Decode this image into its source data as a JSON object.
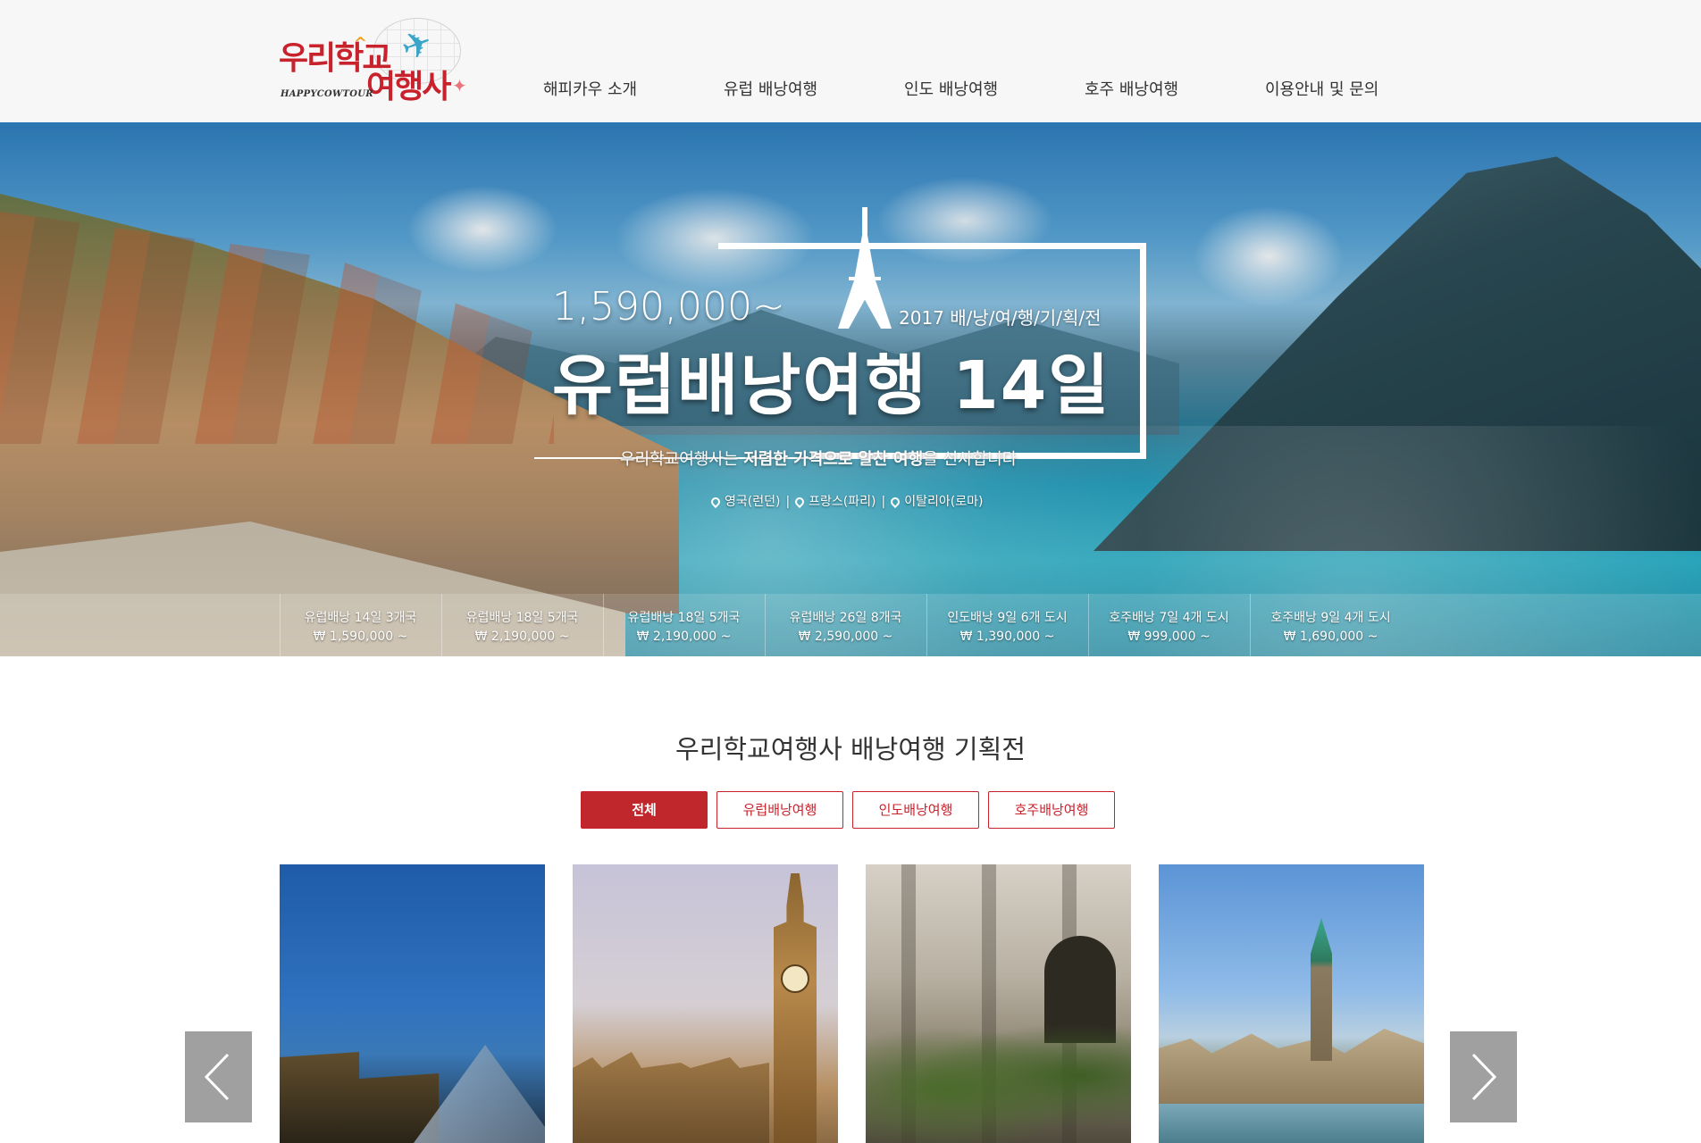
{
  "brand": {
    "logo_line1": "우리학교",
    "logo_line2": "여행사",
    "logo_sub": "HAPPYCOWTOUR",
    "accent_color": "#c8232c"
  },
  "nav": {
    "items": [
      {
        "label": "해피카우 소개"
      },
      {
        "label": "유럽 배낭여행"
      },
      {
        "label": "인도 배낭여행"
      },
      {
        "label": "호주 배낭여행"
      },
      {
        "label": "이용안내 및 문의"
      }
    ]
  },
  "hero": {
    "price": "1,590,000~",
    "subtitle": "2017 배/낭/여/행/기/획/전",
    "title": "유럽배낭여행  14일",
    "tagline_prefix": "우리학교여행사는 ",
    "tagline_bold": "저렴한 가격으로 알찬 여행",
    "tagline_suffix": "을 선사합니다",
    "places": [
      "영국(런던)",
      "프랑스(파리)",
      "이탈리아(로마)"
    ],
    "separator": "|"
  },
  "packages": [
    {
      "name": "유럽배낭 14일 3개국",
      "price": "₩ 1,590,000 ~"
    },
    {
      "name": "유럽배낭 18일 5개국",
      "price": "₩ 2,190,000 ~"
    },
    {
      "name": "유럽배낭 18일 5개국",
      "price": "₩ 2,190,000 ~"
    },
    {
      "name": "유럽배낭 26일 8개국",
      "price": "₩ 2,590,000 ~"
    },
    {
      "name": "인도배낭 9일 6개 도시",
      "price": "₩ 1,390,000 ~"
    },
    {
      "name": "호주배낭 7일 4개 도시",
      "price": "₩ 999,000 ~"
    },
    {
      "name": "호주배낭 9일 4개 도시",
      "price": "₩ 1,690,000 ~"
    }
  ],
  "section": {
    "title": "우리학교여행사 배낭여행 기획전",
    "tabs": [
      {
        "label": "전체",
        "active": true
      },
      {
        "label": "유럽배낭여행",
        "active": false
      },
      {
        "label": "인도배낭여행",
        "active": false
      },
      {
        "label": "호주배낭여행",
        "active": false
      }
    ]
  },
  "carousel": {
    "cards": [
      {
        "icon": "louvre-photo"
      },
      {
        "icon": "big-ben-photo"
      },
      {
        "icon": "street-photo"
      },
      {
        "icon": "zurich-photo"
      }
    ],
    "prev_icon": "chevron-left-icon",
    "next_icon": "chevron-right-icon"
  }
}
